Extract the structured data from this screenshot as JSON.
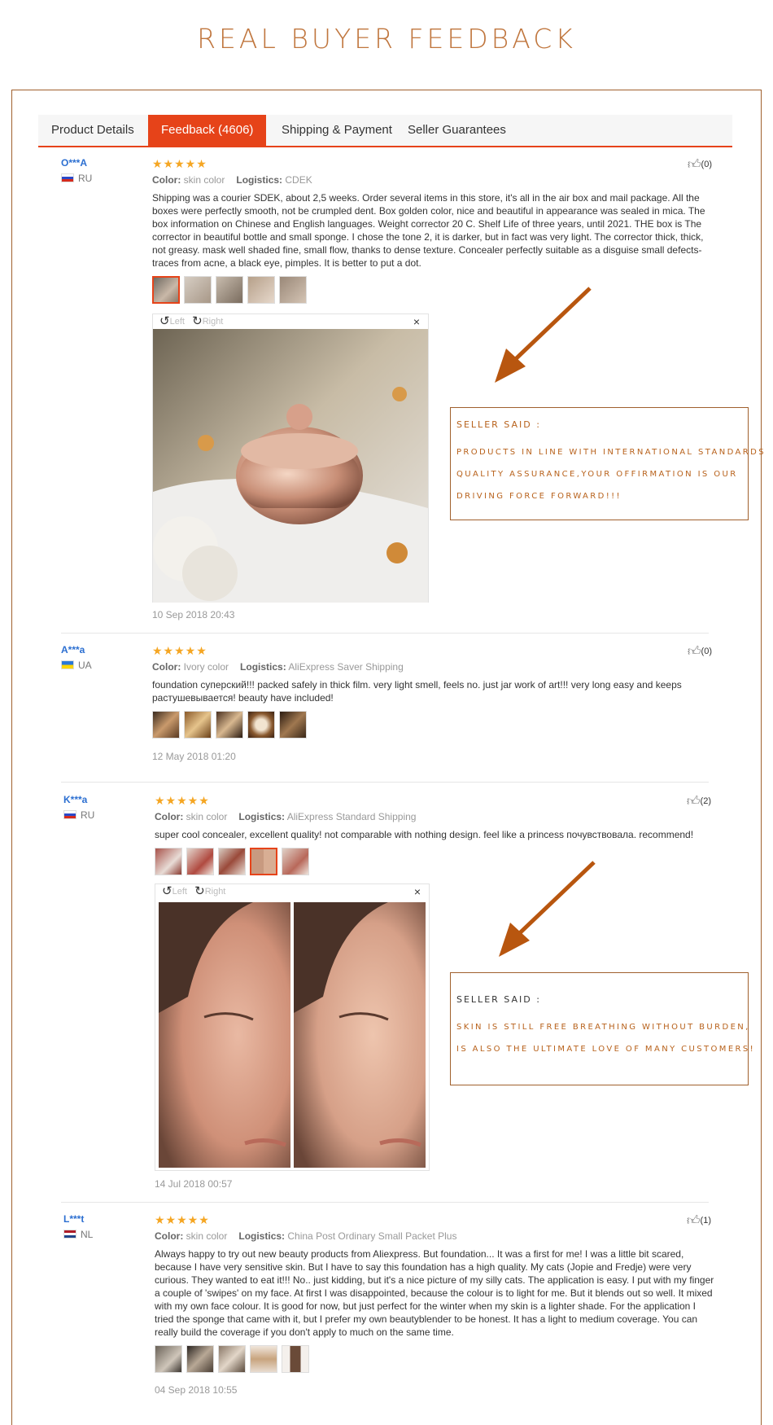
{
  "header": {
    "title": "REAL BUYER FEEDBACK"
  },
  "tabs": [
    {
      "label": "Product Details"
    },
    {
      "label": "Feedback (4606)"
    },
    {
      "label": "Shipping & Payment"
    },
    {
      "label": "Seller Guarantees"
    }
  ],
  "common": {
    "stars": "★★★★★",
    "color_label": "Color:",
    "logistics_label": "Logistics:",
    "viewer_left": "Left",
    "viewer_right": "Right",
    "viewer_close": "×"
  },
  "reviews": [
    {
      "user": "O***A",
      "country": "RU",
      "color": "skin color",
      "logistics": "CDEK",
      "text": "Shipping was a courier SDEK, about 2,5 weeks. Order several items in this store, it's all in the air box and mail package. All the boxes were perfectly smooth, not be crumpled dent. Box golden color, nice and beautiful in appearance was sealed in mica. The box information on Chinese and English languages. Weight corrector 20 C. Shelf Life of three years, until 2021. THE box is The corrector in beautiful bottle and small sponge. I chose the tone 2, it is darker, but in fact was very light. The corrector thick, thick, not greasy. mask well shaded fine, small flow, thanks to dense texture. Concealer perfectly suitable as a disguise small defects-traces from acne, a black eye, pimples. It is better to put a dot.",
      "date": "10 Sep 2018 20:43",
      "likes": "(0)"
    },
    {
      "user": "A***a",
      "country": "UA",
      "color": "Ivory color",
      "logistics": "AliExpress Saver Shipping",
      "text": "foundation суперский!!! packed safely in thick film. very light smell, feels no. just jar work of art!!! very long easy and keeps растушевывается! beauty have included!",
      "date": "12 May 2018 01:20",
      "likes": "(0)"
    },
    {
      "user": "K***a",
      "country": "RU",
      "color": "skin color",
      "logistics": "AliExpress Standard Shipping",
      "text": "super cool concealer, excellent quality! not comparable with nothing design. feel like a princess почувствовала. recommend!",
      "date": "14 Jul 2018 00:57",
      "likes": "(2)"
    },
    {
      "user": "L***t",
      "country": "NL",
      "color": "skin color",
      "logistics": "China Post Ordinary Small Packet Plus",
      "text": "Always happy to try out new beauty products from Aliexpress. But foundation... It was a first for me! I was a little bit scared, because I have very sensitive skin. But I have to say this foundation has a high quality. My cats (Jopie and Fredje) were very curious. They wanted to eat it!!! No.. just kidding, but it's a nice picture of my silly cats. The application is easy. I put with my finger a couple of 'swipes' on my face. At first I was disappointed, because the colour is to light for me. But it blends out so well. It mixed with my own face colour. It is good for now, but just perfect for the winter when my skin is a lighter shade. For the application I tried the sponge that came with it, but I prefer my own beautyblender to be honest. It has a light to medium coverage. You can really build the coverage if you don't apply to much on the same time.",
      "date": "04 Sep 2018 10:55",
      "likes": "(1)"
    }
  ],
  "seller_boxes": [
    {
      "heading": "SELLER SAID :",
      "lines": [
        "PRODUCTS IN LINE WITH INTERNATIONAL STANDARDS",
        "QUALITY ASSURANCE,YOUR OFFIRMATION IS OUR",
        "DRIVING FORCE FORWARD!!!"
      ]
    },
    {
      "heading": "SELLER SAID :",
      "lines": [
        "SKIN IS STILL FREE BREATHING WITHOUT BURDEN,",
        "IS ALSO THE ULTIMATE LOVE OF MANY CUSTOMERS!"
      ]
    }
  ],
  "colors": {
    "accent": "#e64319",
    "brand_brown": "#a0602d",
    "star": "#f5a623",
    "link": "#2c6fd1"
  }
}
